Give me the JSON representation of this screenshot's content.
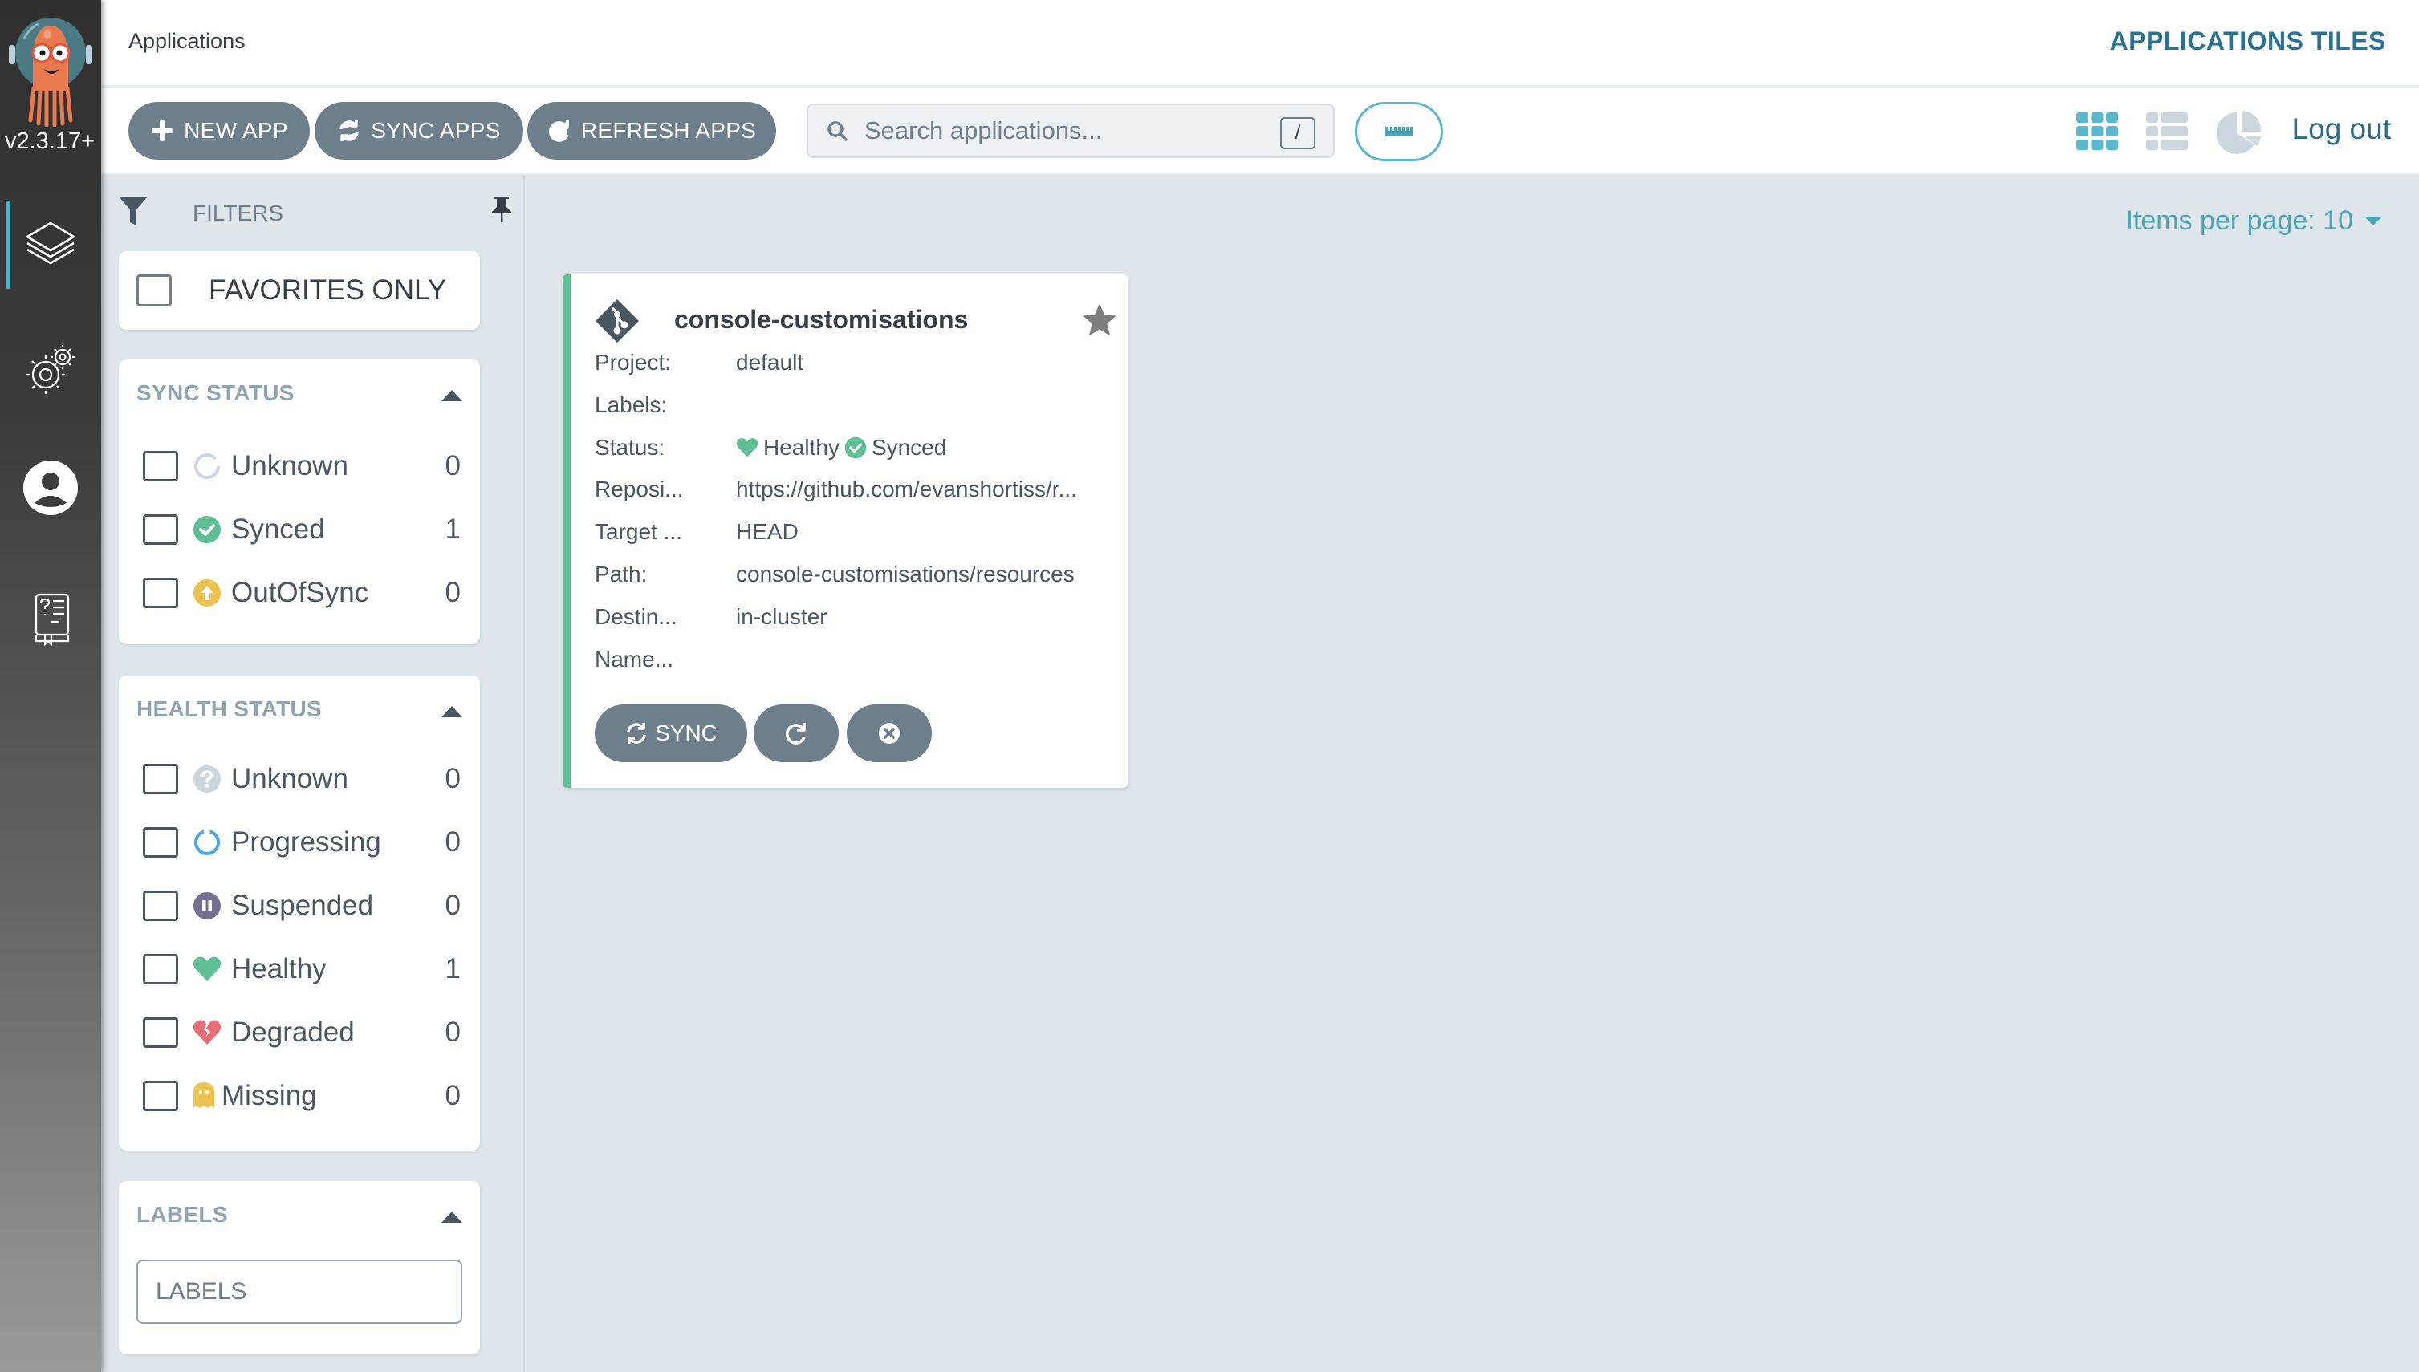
{
  "nav": {
    "version": "v2.3.17+",
    "items": [
      {
        "name": "applications",
        "icon": "layers-icon",
        "active": true
      },
      {
        "name": "settings",
        "icon": "gears-icon",
        "active": false
      },
      {
        "name": "user-info",
        "icon": "user-icon",
        "active": false
      },
      {
        "name": "documentation",
        "icon": "docs-icon",
        "active": false
      }
    ]
  },
  "header": {
    "title": "Applications",
    "view_title": "APPLICATIONS TILES"
  },
  "toolbar": {
    "new_app": "NEW APP",
    "sync_apps": "SYNC APPS",
    "refresh_apps": "REFRESH APPS",
    "search_placeholder": "Search applications...",
    "search_value": "",
    "search_shortcut": "/",
    "views": [
      "tiles",
      "list",
      "summary"
    ],
    "active_view": "tiles",
    "logout": "Log out"
  },
  "filters": {
    "title": "FILTERS",
    "favorites_only": {
      "label": "FAVORITES ONLY",
      "checked": false
    },
    "sync_status": {
      "title": "SYNC STATUS",
      "items": [
        {
          "label": "Unknown",
          "count": "0",
          "icon": "circle-notch-icon",
          "color": "#ccd6dd"
        },
        {
          "label": "Synced",
          "count": "1",
          "icon": "check-circle-icon",
          "color": "#18be94"
        },
        {
          "label": "OutOfSync",
          "count": "0",
          "icon": "arrow-up-circle-icon",
          "color": "#f4c030"
        }
      ]
    },
    "health_status": {
      "title": "HEALTH STATUS",
      "items": [
        {
          "label": "Unknown",
          "count": "0",
          "icon": "question-circle-icon",
          "color": "#ccd6dd"
        },
        {
          "label": "Progressing",
          "count": "0",
          "icon": "circle-notch-icon",
          "color": "#0dadea"
        },
        {
          "label": "Suspended",
          "count": "0",
          "icon": "pause-circle-icon",
          "color": "#766f94"
        },
        {
          "label": "Healthy",
          "count": "1",
          "icon": "heart-icon",
          "color": "#18be94"
        },
        {
          "label": "Degraded",
          "count": "0",
          "icon": "heart-broken-icon",
          "color": "#e96d76"
        },
        {
          "label": "Missing",
          "count": "0",
          "icon": "ghost-icon",
          "color": "#f4c030"
        }
      ]
    },
    "labels": {
      "title": "LABELS",
      "placeholder": "LABELS",
      "value": ""
    }
  },
  "main": {
    "items_per_page": "Items per page: 10",
    "apps": [
      {
        "name": "console-customisations",
        "favorite": false,
        "fields": [
          {
            "key": "Project:",
            "value": "default"
          },
          {
            "key": "Labels:",
            "value": ""
          },
          {
            "key": "Status:",
            "health": "Healthy",
            "sync": "Synced"
          },
          {
            "key": "Reposi...",
            "value": "https://github.com/evanshortiss/r..."
          },
          {
            "key": "Target ...",
            "value": "HEAD"
          },
          {
            "key": "Path:",
            "value": "console-customisations/resources"
          },
          {
            "key": "Destin...",
            "value": "in-cluster"
          },
          {
            "key": "Name...",
            "value": ""
          }
        ],
        "actions": {
          "sync": "SYNC"
        }
      }
    ]
  },
  "colors": {
    "accent": "#4fb3c8",
    "button": "#6d7f8b",
    "healthy": "#18be94",
    "title": "#2a7292"
  }
}
